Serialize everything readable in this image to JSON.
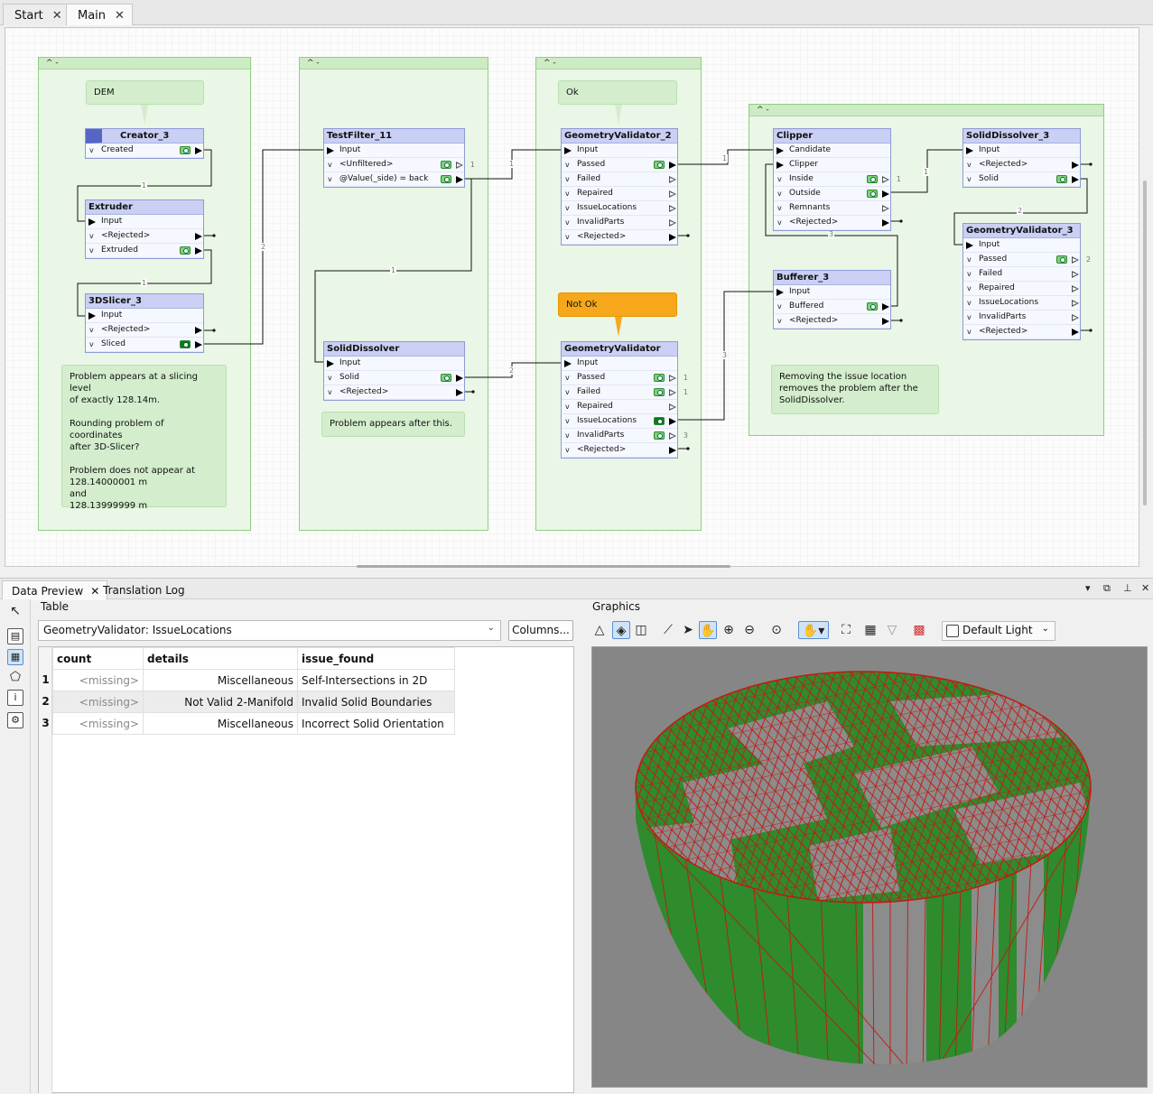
{
  "tabs": [
    {
      "label": "Start"
    },
    {
      "label": "Main"
    }
  ],
  "canvas": {
    "bookmark_toggle": "^  -",
    "annotations": {
      "dem": "DEM",
      "ok": "Ok",
      "not_ok": "Not Ok",
      "slicing_note": "Problem appears at a slicing level\nof exactly 128.14m.\n\nRounding problem of coordinates\nafter 3D-Slicer?\n\nProblem does not appear at\n128.14000001 m\nand\n128.13999999 m",
      "solid_note": "Problem appears after this.",
      "remove_note": "Removing the issue location\nremoves the problem after the\nSolidDissolver."
    },
    "transformers": {
      "creator_3": {
        "name": "Creator_3",
        "ports": [
          "Created"
        ]
      },
      "extruder": {
        "name": "Extruder",
        "ports": [
          "Input",
          "<Rejected>",
          "Extruded"
        ]
      },
      "slicer_3": {
        "name": "3DSlicer_3",
        "ports": [
          "Input",
          "<Rejected>",
          "Sliced"
        ]
      },
      "testfilter_11": {
        "name": "TestFilter_11",
        "ports": [
          "Input",
          "<Unfiltered>",
          "@Value(_side) = back"
        ],
        "counts": [
          "1"
        ]
      },
      "soliddissolver": {
        "name": "SolidDissolver",
        "ports": [
          "Input",
          "Solid",
          "<Rejected>"
        ]
      },
      "geomvalidator_2": {
        "name": "GeometryValidator_2",
        "ports": [
          "Input",
          "Passed",
          "Failed",
          "Repaired",
          "IssueLocations",
          "InvalidParts",
          "<Rejected>"
        ]
      },
      "geomvalidator": {
        "name": "GeometryValidator",
        "ports": [
          "Input",
          "Passed",
          "Failed",
          "Repaired",
          "IssueLocations",
          "InvalidParts",
          "<Rejected>"
        ],
        "counts": [
          "1",
          "1",
          "3"
        ]
      },
      "clipper": {
        "name": "Clipper",
        "ports": [
          "Candidate",
          "Clipper",
          "Inside",
          "Outside",
          "Remnants",
          "<Rejected>"
        ],
        "counts": [
          "1"
        ]
      },
      "bufferer_3": {
        "name": "Bufferer_3",
        "ports": [
          "Input",
          "Buffered",
          "<Rejected>"
        ]
      },
      "soliddissolver_3": {
        "name": "SolidDissolver_3",
        "ports": [
          "Input",
          "<Rejected>",
          "Solid"
        ]
      },
      "geomvalidator_3": {
        "name": "GeometryValidator_3",
        "ports": [
          "Input",
          "Passed",
          "Failed",
          "Repaired",
          "IssueLocations",
          "InvalidParts",
          "<Rejected>"
        ],
        "counts": [
          "2"
        ]
      }
    },
    "wire_labels": [
      "1",
      "1",
      "2",
      "1",
      "1",
      "2",
      "1",
      "1",
      "2",
      "3",
      "3"
    ]
  },
  "panel": {
    "tabs": [
      {
        "label": "Data Preview"
      },
      {
        "label": "Translation Log"
      }
    ],
    "controls": [
      "▾",
      "⧉",
      "⊥",
      "✕"
    ],
    "table_label": "Table",
    "graphics_label": "Graphics",
    "selector_value": "GeometryValidator: IssueLocations",
    "columns_button": "Columns...",
    "columns": [
      "count",
      "details",
      "issue_found"
    ],
    "rows": [
      {
        "n": "1",
        "count": "<missing>",
        "details": "Miscellaneous",
        "issue_found": "Self-Intersections in 2D"
      },
      {
        "n": "2",
        "count": "<missing>",
        "details": "Not Valid 2-Manifold",
        "issue_found": "Invalid Solid Boundaries"
      },
      {
        "n": "3",
        "count": "<missing>",
        "details": "Miscellaneous",
        "issue_found": "Incorrect Solid Orientation"
      }
    ],
    "theme": "Default Light"
  },
  "colors": {
    "bookmark": "#eaf6e6",
    "transformer_header": "#c9d0f4",
    "annotation": "#d3edcd",
    "warning": "#f6a81a",
    "mesh_green": "#2e8b2e",
    "mesh_gray": "#8c8c8c",
    "mesh_edge": "#c21a12"
  }
}
